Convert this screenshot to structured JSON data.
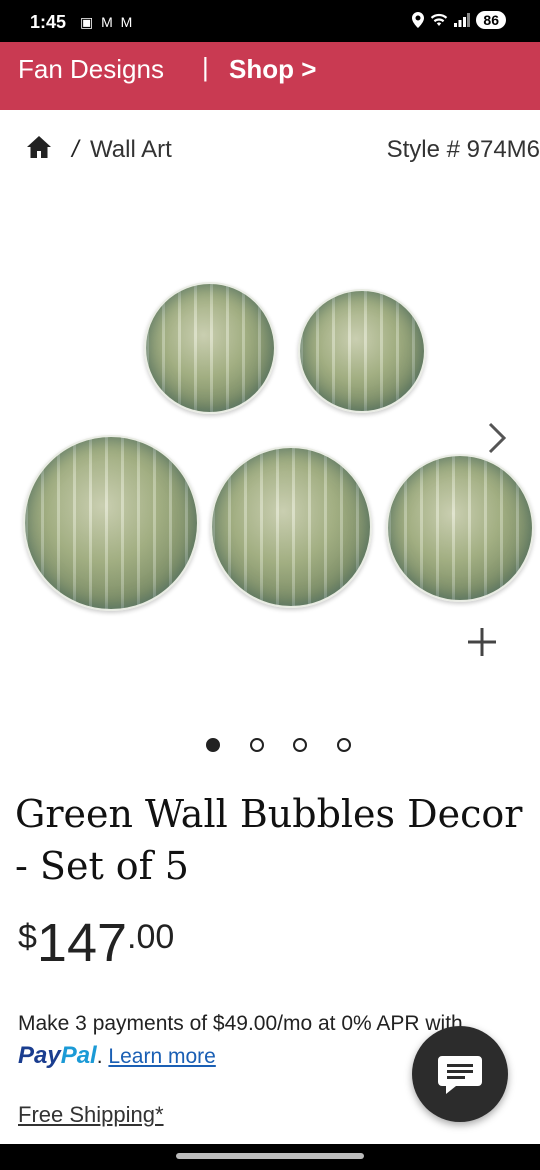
{
  "status_bar": {
    "time": "1:45",
    "left_icons": "▣ M M",
    "battery": "86"
  },
  "banner": {
    "left": "Fan Designs",
    "separator": "|",
    "right": "Shop >"
  },
  "breadcrumb": {
    "slash": "/",
    "current": "Wall Art",
    "style": "Style # 974M6"
  },
  "gallery": {
    "next_icon": "chevron-right",
    "zoom_icon": "plus",
    "slide_count": 4,
    "active_slide": 1
  },
  "product": {
    "title": "Green Wall Bubbles Decor - Set of 5",
    "price_currency": "$",
    "price_whole": "147",
    "price_cents": ".00"
  },
  "payment": {
    "text": "Make 3 payments of $49.00/mo at 0% APR with",
    "paypal_pay": "Pay",
    "paypal_pal": "Pal",
    "period": ".",
    "learn_more": "Learn more"
  },
  "shipping": {
    "label": "Free Shipping*"
  },
  "colors": {
    "banner": "#c93a52",
    "link": "#1a5fb4",
    "paypal_dark": "#1a3d8f",
    "paypal_light": "#1b9ad6"
  }
}
